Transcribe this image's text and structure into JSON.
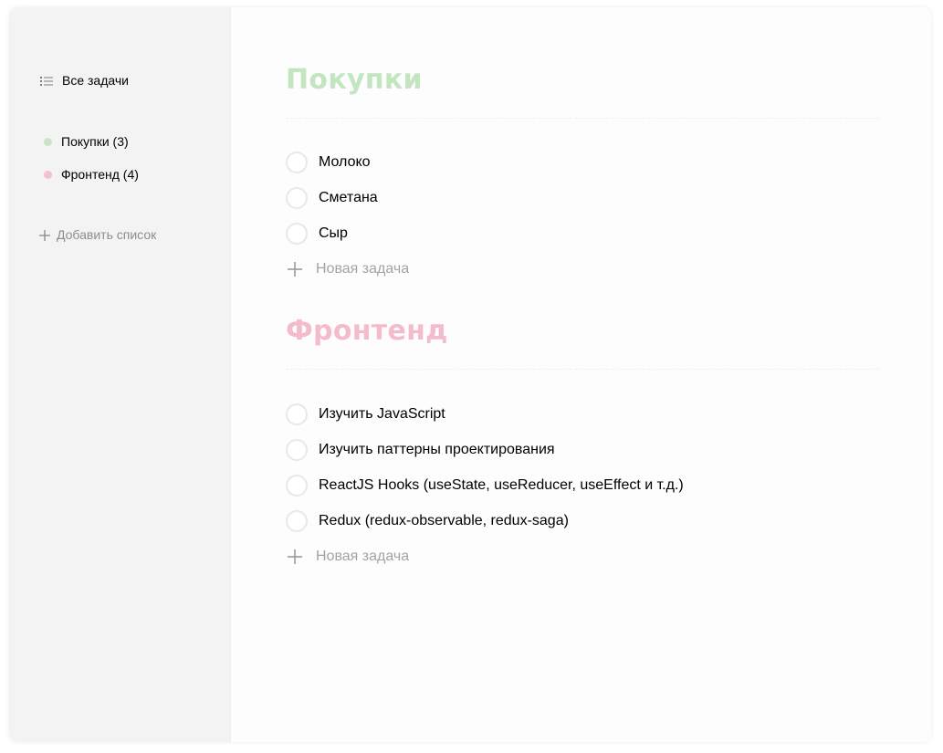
{
  "sidebar": {
    "all_tasks_label": "Все задачи",
    "lists": [
      {
        "label": "Покупки (3)",
        "color": "#c8e6c5"
      },
      {
        "label": "Фронтенд (4)",
        "color": "#f4c0cc"
      }
    ],
    "add_list_label": "Добавить список"
  },
  "main": {
    "lists": [
      {
        "title": "Покупки",
        "color": "#c3e5c0",
        "tasks": [
          "Молоко",
          "Сметана",
          "Сыр"
        ],
        "new_task_label": "Новая задача"
      },
      {
        "title": "Фронтенд",
        "color": "#f4bccb",
        "tasks": [
          "Изучить JavaScript",
          "Изучить паттерны проектирования",
          "ReactJS Hooks (useState, useReducer, useEffect и т.д.)",
          "Redux (redux-observable, redux-saga)"
        ],
        "new_task_label": "Новая задача"
      }
    ]
  },
  "icons": {
    "all_tasks": "list-icon",
    "add_list": "plus-icon",
    "new_task": "plus-icon"
  }
}
